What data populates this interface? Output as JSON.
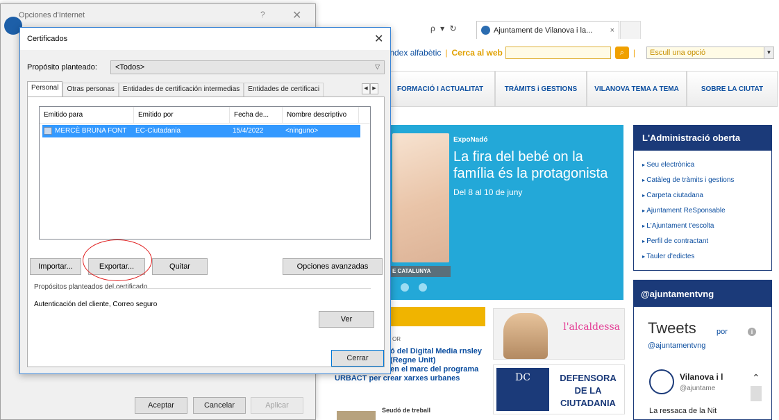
{
  "browser": {
    "search_controls": "ρ ▾ ↻",
    "tab_label": "Ajuntament de Vilanova i la...",
    "tab_close": "×",
    "toolbar": {
      "alpha_index": "Índex alfabètic",
      "web_search": "Cerca al web",
      "search_go": "⌕",
      "select_placeholder": "Escull una opció"
    },
    "nav": [
      "FORMACIÓ I ACTUALITAT",
      "TRÀMITS i GESTIONS",
      "VILANOVA TEMA A TEMA",
      "SOBRE LA CIUTAT"
    ],
    "hero": {
      "tag": "ExpoNadó",
      "title": "La fira del bebé on la família és la protagonista",
      "date": "Del 8 al 10 de juny",
      "caption": "E CATALUNYA"
    },
    "news": {
      "sub": "OR",
      "text1": "ó del Digital Media rnsley (Regne Unit)",
      "text2": "visita Neapolis en el marc del programa URBACT per crear xarxes urbanes",
      "seu": "Seudó de treball"
    },
    "alcaldessa": "l'alcaldessa",
    "defensora": {
      "logo": "DC",
      "text": "DEFENSORA DE LA CIUTADANIA"
    },
    "admin": {
      "title": "L'Administració oberta",
      "items": [
        "Seu electrònica",
        "Catàleg de tràmits i gestions",
        "Carpeta ciutadana",
        "Ajuntament ReSponsable",
        "L'Ajuntament t'escolta",
        "Perfil de contractant",
        "Tauler d'edictes"
      ]
    },
    "twitter": {
      "title": "@ajuntamentvng",
      "tweets": "Tweets",
      "por": "por",
      "handle": "@ajuntamentvng",
      "name": "Vilanova i l",
      "at": "@ajuntame",
      "body": "La ressaca de la Nit"
    }
  },
  "opciones": {
    "title": "Opciones d'Internet",
    "help": "?",
    "close": "✕",
    "buttons": {
      "accept": "Aceptar",
      "cancel": "Cancelar",
      "apply": "Aplicar"
    }
  },
  "cert": {
    "title": "Certificados",
    "close": "✕",
    "purpose_label": "Propósito planteado:",
    "purpose_value": "<Todos>",
    "tabs": [
      "Personal",
      "Otras personas",
      "Entidades de certificación intermedias",
      "Entidades de certificaci"
    ],
    "columns": [
      "Emitido para",
      "Emitido por",
      "Fecha de...",
      "Nombre descriptivo"
    ],
    "rows": [
      {
        "issued_to": "MERCÈ BRUNA FONT",
        "issued_by": "EC-Ciutadania",
        "date": "15/4/2022",
        "friendly": "<ninguno>"
      }
    ],
    "buttons": {
      "import": "Importar...",
      "export": "Exportar...",
      "remove": "Quitar",
      "advanced": "Opciones avanzadas",
      "view": "Ver",
      "close": "Cerrar"
    },
    "purposes_label": "Propósitos planteados del certificado",
    "purposes_value": "Autenticación del cliente, Correo seguro"
  }
}
